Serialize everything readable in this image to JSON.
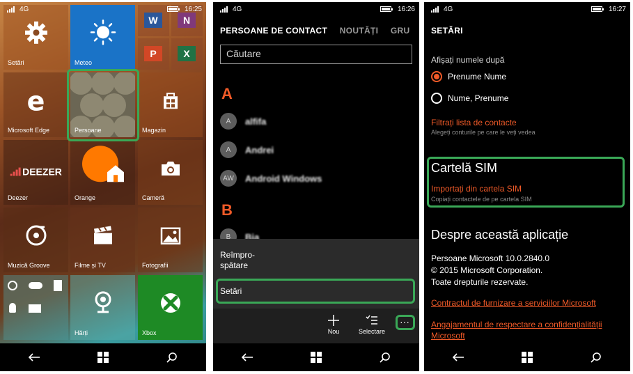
{
  "screens": {
    "start": {
      "status": {
        "network": "4G",
        "time": "16:25"
      },
      "tiles": {
        "settings": "Setări",
        "weather": "Meteo",
        "edge": "Microsoft Edge",
        "people": "Persoane",
        "store": "Magazin",
        "deezer": "Deezer",
        "deezer_logo": "DEEZER",
        "orange": "Orange",
        "camera": "Cameră",
        "groove": "Muzică Groove",
        "films": "Filme și TV",
        "photos": "Fotografii",
        "maps": "Hărți",
        "xbox": "Xbox"
      },
      "office_tiles": {
        "word": "W",
        "onenote": "N",
        "powerpoint": "P",
        "excel": "X"
      }
    },
    "contacts": {
      "status": {
        "network": "4G",
        "time": "16:26"
      },
      "tabs": [
        "PERSOANE DE CONTACT",
        "NOUTĂȚI",
        "GRU"
      ],
      "search_placeholder": "Căutare",
      "groups": [
        {
          "letter": "A",
          "contacts": [
            {
              "initials": "A",
              "name": "alfifa"
            },
            {
              "initials": "A",
              "name": "Andrei"
            },
            {
              "initials": "AW",
              "name": "Android Windows"
            }
          ]
        },
        {
          "letter": "B",
          "contacts": [
            {
              "initials": "B",
              "name": "Bia"
            }
          ]
        }
      ],
      "menu": {
        "refresh_line1": "Reîmpro-",
        "refresh_line2": "spătare",
        "settings": "Setări"
      },
      "appbar": {
        "new": "Nou",
        "select": "Selectare",
        "more": "···"
      }
    },
    "settings": {
      "status": {
        "network": "4G",
        "time": "16:27"
      },
      "title": "SETĂRI",
      "display_names_label": "Afișați numele după",
      "options": [
        "Prenume Nume",
        "Nume, Prenume"
      ],
      "selected_option": 0,
      "filter_link": "Filtrați lista de contacte",
      "filter_sub": "Alegeți conturile pe care le veți vedea",
      "sim_section": "Cartelă SIM",
      "sim_import_link": "Importați din cartela SIM",
      "sim_import_sub": "Copiați contactele de pe cartela SIM",
      "about_section": "Despre această aplicație",
      "about_lines": [
        "Persoane Microsoft 10.0.2840.0",
        "© 2015 Microsoft Corporation.",
        "Toate drepturile rezervate."
      ],
      "terms_link": "Contractul de furnizare a serviciilor Microsoft",
      "privacy_link": "Angajamentul de respectare a confidențialității Microsoft"
    }
  },
  "colors": {
    "highlight": "#3aa857",
    "accent": "#f05a28",
    "weather_tile": "#1a73c7",
    "xbox_tile": "#1e8a25",
    "word": "#2b579a",
    "onenote": "#80397b",
    "powerpoint": "#d24726",
    "excel": "#207245"
  }
}
